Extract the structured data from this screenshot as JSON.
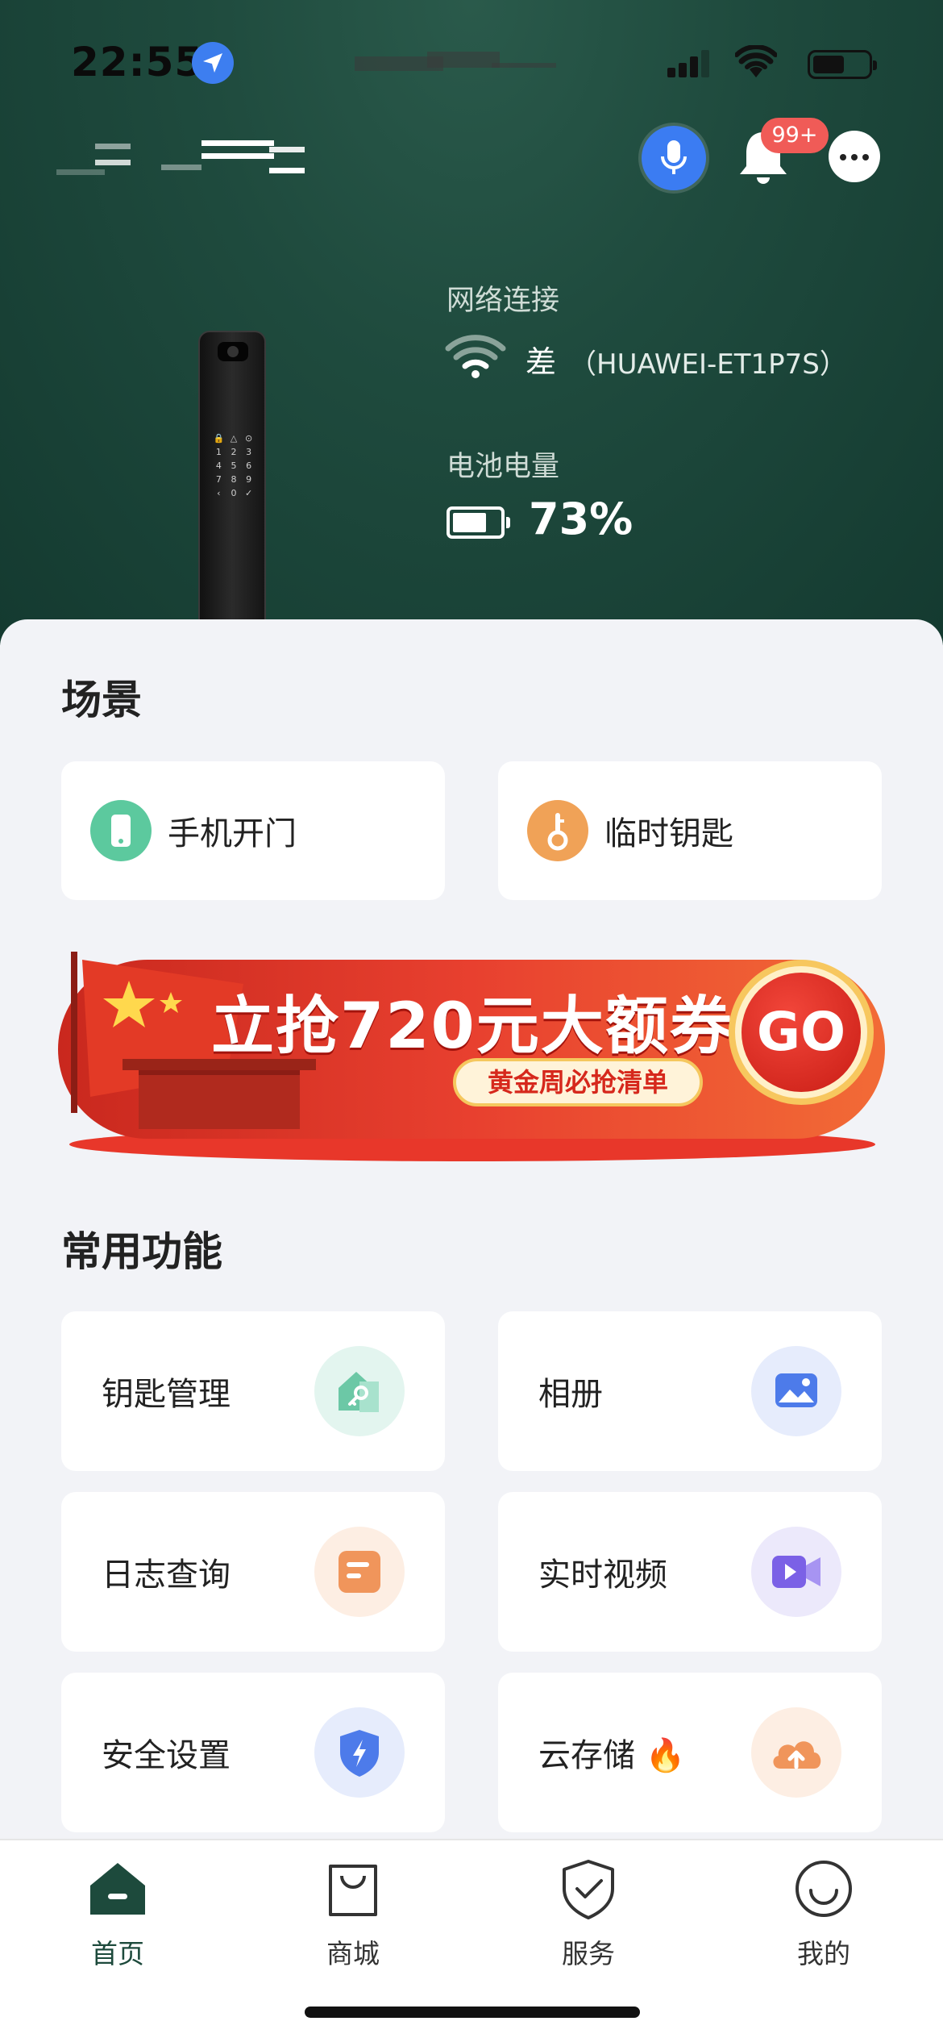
{
  "status_bar": {
    "time": "22:55"
  },
  "header": {
    "notification_badge": "99+"
  },
  "device_info": {
    "network_label": "网络连接",
    "network_status": "差",
    "network_ssid": "（HUAWEI-ET1P7S）",
    "battery_label": "电池电量",
    "battery_value": "73%",
    "battery_level": 0.73
  },
  "scenes": {
    "title": "场景",
    "items": [
      {
        "label": "手机开门",
        "icon": "phone-icon",
        "color": "#5cc99e"
      },
      {
        "label": "临时钥匙",
        "icon": "key-icon",
        "color": "#f0a257"
      }
    ]
  },
  "banner": {
    "title": "立抢720元大额券",
    "subtitle": "黄金周必抢清单",
    "go": "GO"
  },
  "functions": {
    "title": "常用功能",
    "items": [
      {
        "label": "钥匙管理",
        "icon": "key-house-icon",
        "bg": "#e3f5ef",
        "fg": "#6cc8a6"
      },
      {
        "label": "相册",
        "icon": "album-icon",
        "bg": "#e6ecfc",
        "fg": "#4d7bea"
      },
      {
        "label": "日志查询",
        "icon": "log-icon",
        "bg": "#fdeee3",
        "fg": "#f0955b"
      },
      {
        "label": "实时视频",
        "icon": "video-icon",
        "bg": "#ece9fb",
        "fg": "#7b61e6"
      },
      {
        "label": "安全设置",
        "icon": "shield-icon",
        "bg": "#e6ecfc",
        "fg": "#4d7bea"
      },
      {
        "label": "云存储",
        "icon": "cloud-upload-icon",
        "bg": "#fdeee3",
        "fg": "#f0955b",
        "emoji": "🔥"
      }
    ]
  },
  "tabbar": {
    "items": [
      {
        "label": "首页",
        "icon": "home-icon",
        "active": true
      },
      {
        "label": "商城",
        "icon": "shopping-bag-icon",
        "active": false
      },
      {
        "label": "服务",
        "icon": "service-shield-icon",
        "active": false
      },
      {
        "label": "我的",
        "icon": "smile-icon",
        "active": false
      }
    ]
  }
}
